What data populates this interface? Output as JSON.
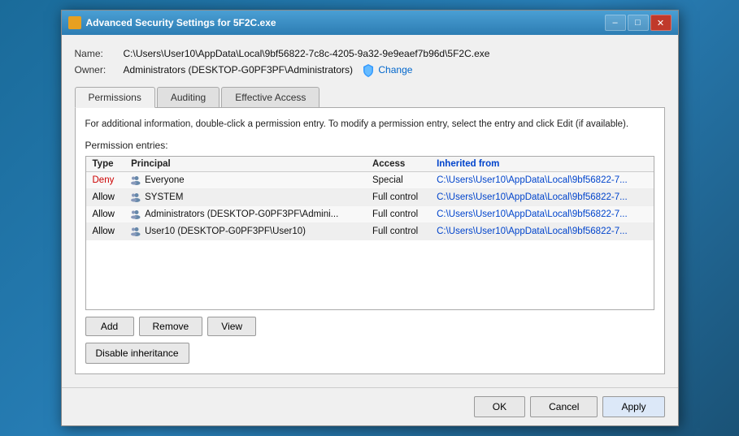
{
  "window": {
    "title": "Advanced Security Settings for 5F2C.exe",
    "icon_color": "#e8a020"
  },
  "info": {
    "name_label": "Name:",
    "name_value": "C:\\Users\\User10\\AppData\\Local\\9bf56822-7c8c-4205-9a32-9e9eaef7b96d\\5F2C.exe",
    "owner_label": "Owner:",
    "owner_value": "Administrators (DESKTOP-G0PF3PF\\Administrators)",
    "change_link": "Change"
  },
  "tabs": [
    {
      "id": "permissions",
      "label": "Permissions",
      "active": true
    },
    {
      "id": "auditing",
      "label": "Auditing",
      "active": false
    },
    {
      "id": "effective-access",
      "label": "Effective Access",
      "active": false
    }
  ],
  "description": "For additional information, double-click a permission entry. To modify a permission entry, select the entry and click Edit (if available).",
  "section_label": "Permission entries:",
  "table": {
    "headers": [
      "Type",
      "Principal",
      "Access",
      "Inherited from"
    ],
    "rows": [
      {
        "type": "Deny",
        "type_class": "deny",
        "principal": "Everyone",
        "access": "Special",
        "inherited": "C:\\Users\\User10\\AppData\\Local\\9bf56822-7..."
      },
      {
        "type": "Allow",
        "type_class": "allow",
        "principal": "SYSTEM",
        "access": "Full control",
        "inherited": "C:\\Users\\User10\\AppData\\Local\\9bf56822-7..."
      },
      {
        "type": "Allow",
        "type_class": "allow",
        "principal": "Administrators (DESKTOP-G0PF3PF\\Admini...",
        "access": "Full control",
        "inherited": "C:\\Users\\User10\\AppData\\Local\\9bf56822-7..."
      },
      {
        "type": "Allow",
        "type_class": "allow",
        "principal": "User10 (DESKTOP-G0PF3PF\\User10)",
        "access": "Full control",
        "inherited": "C:\\Users\\User10\\AppData\\Local\\9bf56822-7..."
      }
    ]
  },
  "buttons": {
    "add": "Add",
    "remove": "Remove",
    "view": "View",
    "disable_inheritance": "Disable inheritance"
  },
  "footer": {
    "ok": "OK",
    "cancel": "Cancel",
    "apply": "Apply"
  }
}
